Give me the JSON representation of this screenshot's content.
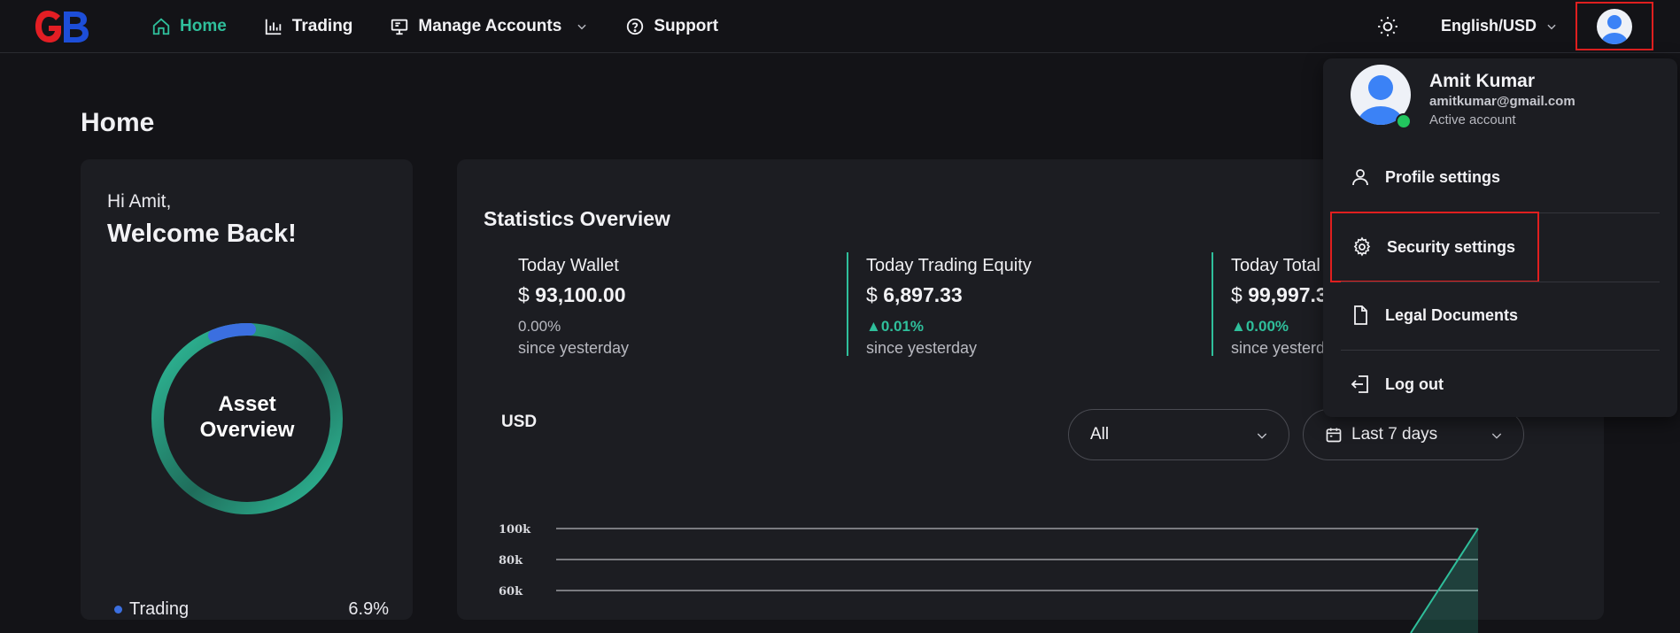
{
  "brand": {
    "logo_text": "GB",
    "logo_colors": [
      "#e31e24",
      "#1d4ed8"
    ]
  },
  "nav": {
    "items": [
      {
        "label": "Home",
        "icon": "home-icon",
        "active": true
      },
      {
        "label": "Trading",
        "icon": "bar-chart-icon"
      },
      {
        "label": "Manage Accounts",
        "icon": "monitor-icon",
        "has_dropdown": true
      },
      {
        "label": "Support",
        "icon": "help-circle-icon"
      }
    ],
    "language": "English/USD"
  },
  "page": {
    "title": "Home"
  },
  "welcome": {
    "greeting": "Hi Amit,",
    "headline": "Welcome Back!",
    "donut_label_line1": "Asset",
    "donut_label_line2": "Overview",
    "legend": [
      {
        "label": "Trading",
        "value": "6.9%",
        "color": "#3b6fe0"
      }
    ]
  },
  "stats": {
    "title": "Statistics Overview",
    "items": [
      {
        "label": "Today Wallet",
        "currency": "$",
        "value": "93,100.00",
        "change": "0.00%",
        "change_up": false,
        "since": "since yesterday"
      },
      {
        "label": "Today Trading Equity",
        "currency": "$",
        "value": "6,897.33",
        "change": "▲0.01%",
        "change_up": true,
        "since": "since yesterday"
      },
      {
        "label": "Today Total",
        "currency": "$",
        "value": "99,997.3",
        "change": "▲0.00%",
        "change_up": true,
        "since": "since yesterd"
      }
    ],
    "unit_label": "USD",
    "filter_type": "All",
    "filter_range": "Last 7 days"
  },
  "chart_data": {
    "type": "area",
    "y_ticks": [
      "100k",
      "80k",
      "60k"
    ],
    "ylim": [
      60000,
      100000
    ],
    "series_color": "#2fbf9b"
  },
  "user_menu": {
    "name": "Amit Kumar",
    "email": "amitkumar@gmail.com",
    "status": "Active account",
    "items": [
      {
        "label": "Profile settings",
        "icon": "user-icon"
      },
      {
        "label": "Security settings",
        "icon": "gear-icon"
      },
      {
        "label": "Legal Documents",
        "icon": "document-icon"
      },
      {
        "label": "Log out",
        "icon": "logout-icon"
      }
    ]
  },
  "colors": {
    "accent": "#2fbf9b",
    "highlight_border": "#e01f1f",
    "background": "#131317",
    "card": "#1c1d22"
  }
}
